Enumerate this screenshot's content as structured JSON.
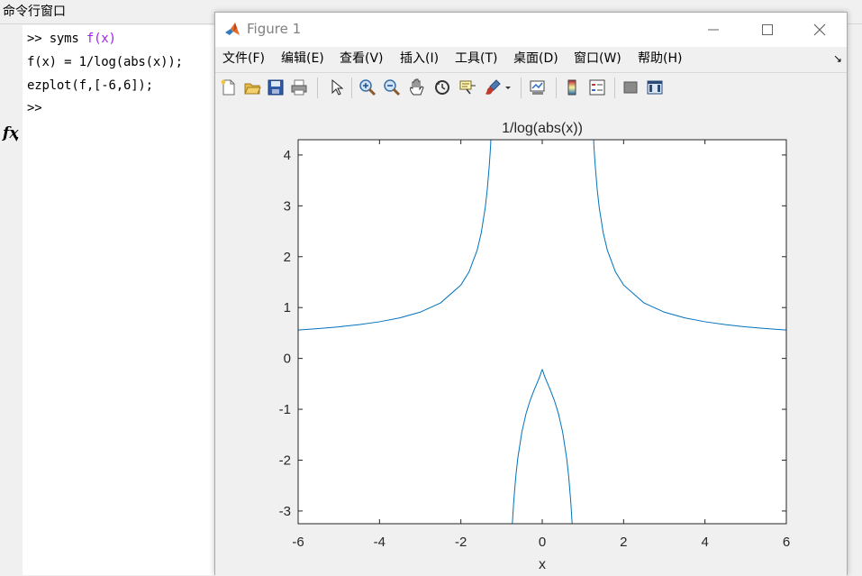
{
  "command_window": {
    "title": "命令行窗口",
    "lines": [
      {
        "prompt": ">> ",
        "text": "syms ",
        "highlight": "f(x)"
      },
      {
        "prompt": "",
        "text": "f(x) = 1/log(abs(x));",
        "highlight": ""
      },
      {
        "prompt": "",
        "text": "ezplot(f,[-6,6]);",
        "highlight": ""
      }
    ],
    "current_prompt": ">>",
    "fx_label": "fx",
    "highlight_color": "#a020f0"
  },
  "figure": {
    "title": "Figure 1",
    "menus": [
      "文件(F)",
      "编辑(E)",
      "查看(V)",
      "插入(I)",
      "工具(T)",
      "桌面(D)",
      "窗口(W)",
      "帮助(H)"
    ],
    "toolbar_icons": [
      "new-figure-icon",
      "open-file-icon",
      "save-icon",
      "print-icon",
      "pointer-icon",
      "zoom-in-icon",
      "zoom-out-icon",
      "pan-icon",
      "rotate-icon",
      "data-cursor-icon",
      "brush-icon",
      "link-plot-icon",
      "colorbar-icon",
      "legend-icon",
      "hide-plot-tools-icon",
      "show-plot-tools-icon"
    ]
  },
  "chart_data": {
    "type": "line",
    "title": "1/log(abs(x))",
    "xlabel": "x",
    "ylabel": "",
    "xlim": [
      -6,
      6
    ],
    "ylim": [
      -3.25,
      4.3
    ],
    "xticks": [
      -6,
      -4,
      -2,
      0,
      2,
      4,
      6
    ],
    "yticks": [
      -3,
      -2,
      -1,
      0,
      1,
      2,
      3,
      4
    ],
    "grid": false,
    "line_color": "#0072bd",
    "series": [
      {
        "x": [
          -6,
          -5.5,
          -5,
          -4.5,
          -4,
          -3.5,
          -3,
          -2.5,
          -2,
          -1.8,
          -1.6,
          -1.5,
          -1.4,
          -1.35,
          -1.3,
          -1.28,
          -1.27,
          -1.263
        ],
        "y": [
          0.558,
          0.587,
          0.621,
          0.665,
          0.721,
          0.798,
          0.91,
          1.091,
          1.443,
          1.701,
          2.128,
          2.466,
          2.972,
          3.332,
          3.811,
          4.05,
          4.18,
          4.3
        ]
      },
      {
        "x": [
          1.263,
          1.27,
          1.28,
          1.3,
          1.35,
          1.4,
          1.5,
          1.6,
          1.8,
          2,
          2.5,
          3,
          3.5,
          4,
          4.5,
          5,
          5.5,
          6
        ],
        "y": [
          4.3,
          4.18,
          4.05,
          3.811,
          3.332,
          2.972,
          2.466,
          2.128,
          1.701,
          1.443,
          1.091,
          0.91,
          0.798,
          0.721,
          0.665,
          0.621,
          0.587,
          0.558
        ]
      },
      {
        "x": [
          -0.736,
          -0.7,
          -0.65,
          -0.6,
          -0.5,
          -0.4,
          -0.3,
          -0.2,
          -0.1,
          -0.05,
          -0.02,
          0,
          0.02,
          0.05,
          0.1,
          0.2,
          0.3,
          0.4,
          0.5,
          0.6,
          0.65,
          0.7,
          0.736
        ],
        "y": [
          -3.26,
          -2.804,
          -2.321,
          -1.958,
          -1.443,
          -1.091,
          -0.831,
          -0.621,
          -0.434,
          -0.334,
          -0.256,
          -0.22,
          -0.256,
          -0.334,
          -0.434,
          -0.621,
          -0.831,
          -1.091,
          -1.443,
          -1.958,
          -2.321,
          -2.804,
          -3.26
        ]
      }
    ]
  }
}
